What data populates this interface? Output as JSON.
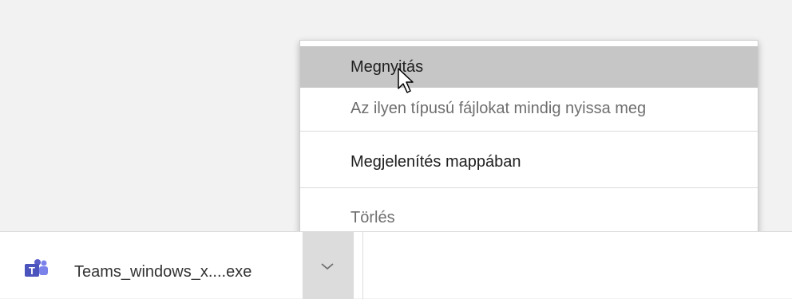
{
  "download_shelf": {
    "file_name": "Teams_windows_x....exe",
    "file_icon": "teams-icon",
    "dropdown_icon": "chevron-down-icon"
  },
  "context_menu": {
    "items": [
      {
        "label": "Megnyitás",
        "state": "highlighted"
      },
      {
        "label": "Az ilyen típusú fájlokat mindig nyissa meg",
        "state": "normal"
      },
      {
        "label": "Megjelenítés mappában",
        "state": "normal"
      },
      {
        "label": "Törlés",
        "state": "normal"
      }
    ]
  },
  "colors": {
    "page_bg": "#f2f2f2",
    "menu_highlight": "#c6c6c6",
    "dropdown_active": "#dcdcdc",
    "teams_purple": "#5b5fc7"
  },
  "cursor_icon": "mouse-pointer-icon"
}
